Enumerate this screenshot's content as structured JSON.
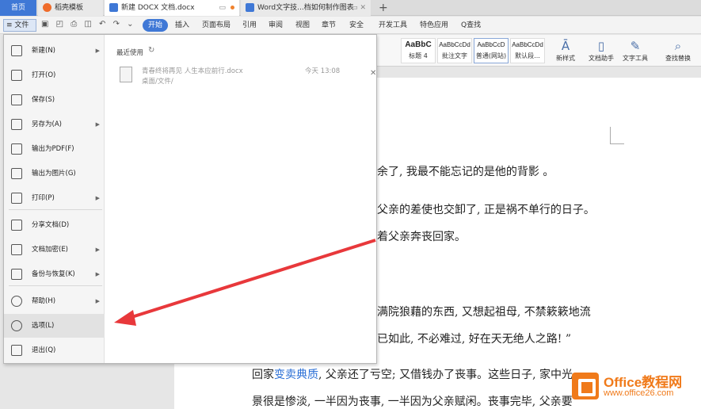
{
  "tabs": [
    {
      "label": "首页",
      "kind": "home"
    },
    {
      "label": "稻壳模板",
      "kind": "docer"
    },
    {
      "label": "新建 DOCX 文档.docx",
      "kind": "doc"
    },
    {
      "label": "Word文字技...档如何制作图表",
      "kind": "doc"
    }
  ],
  "tab_plus": "+",
  "menu": {
    "file": "≡ 文件",
    "items": [
      "开始",
      "插入",
      "页面布局",
      "引用",
      "审阅",
      "视图",
      "章节",
      "安全",
      "开发工具",
      "特色应用",
      "Q查找"
    ]
  },
  "ribbon": {
    "styles": [
      {
        "sample": "AaBbC",
        "label": "标题 4"
      },
      {
        "sample": "AaBbCcDd",
        "label": "批注文字"
      },
      {
        "sample": "AaBbCcD",
        "label": "普通(网站)"
      },
      {
        "sample": "AaBbCcDd",
        "label": "默认段..."
      }
    ],
    "buttons": [
      "新样式",
      "文档助手",
      "文字工具",
      "查找替换"
    ]
  },
  "file_menu": {
    "items": [
      {
        "label": "新建(N)",
        "icon": "new-file-icon",
        "arrow": true
      },
      {
        "label": "打开(O)",
        "icon": "folder-icon",
        "arrow": false
      },
      {
        "label": "保存(S)",
        "icon": "save-icon",
        "arrow": false
      },
      {
        "label": "另存为(A)",
        "icon": "save-as-icon",
        "arrow": true
      },
      {
        "label": "输出为PDF(F)",
        "icon": "pdf-icon",
        "arrow": false
      },
      {
        "label": "输出为图片(G)",
        "icon": "image-icon",
        "arrow": false
      },
      {
        "label": "打印(P)",
        "icon": "print-icon",
        "arrow": true
      },
      {
        "label": "分享文档(D)",
        "icon": "share-icon",
        "arrow": false
      },
      {
        "label": "文档加密(E)",
        "icon": "lock-icon",
        "arrow": true
      },
      {
        "label": "备份与恢复(K)",
        "icon": "backup-icon",
        "arrow": true
      },
      {
        "label": "帮助(H)",
        "icon": "help-icon",
        "arrow": true
      },
      {
        "label": "选项(L)",
        "icon": "gear-icon",
        "arrow": false
      },
      {
        "label": "退出(Q)",
        "icon": "exit-icon",
        "arrow": false
      }
    ],
    "recent_title": "最近使用",
    "recent_files": [
      {
        "name": "青春终将再见 人生本应前行.docx",
        "path": "桌面/文件/",
        "time": "今天 13:08"
      }
    ]
  },
  "document": {
    "lines": [
      "余了, 我最不能忘记的是他的背影 。",
      "父亲的差使也交卸了, 正是祸不单行的日子。",
      "着父亲奔丧回家。",
      "满院狼藉的东西, 又想起祖母, 不禁簌簌地流",
      "已如此, 不必难过, 好在天无绝人之路! ”",
      "回家变卖典质, 父亲还了亏空; 又借钱办了丧事。这些日子, 家中光",
      "景很是惨淡, 一半因为丧事, 一半因为父亲赋闲。丧事完毕, 父亲要"
    ],
    "highlight": "变卖典质"
  },
  "watermark": {
    "title": "Office教程网",
    "url": "www.office26.com"
  },
  "colors": {
    "accent": "#3f78d6",
    "arrow": "#e8383b",
    "logo": "#f07a1a"
  }
}
